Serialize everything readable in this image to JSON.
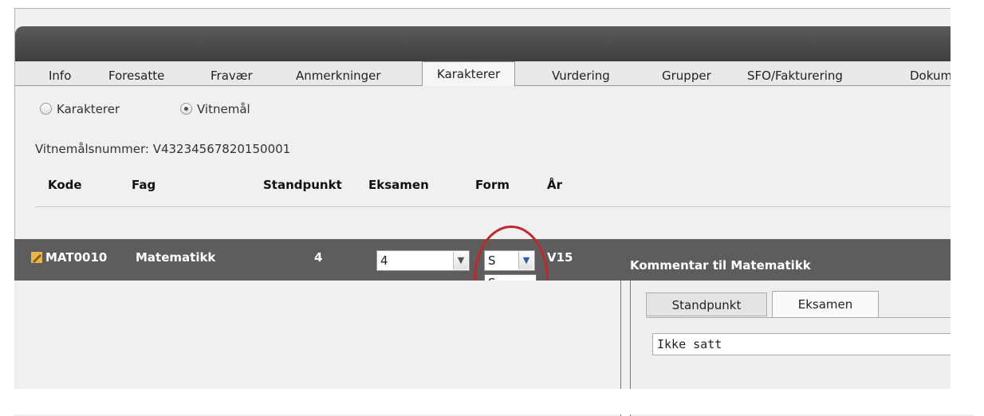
{
  "tabs": [
    {
      "label": "Info"
    },
    {
      "label": "Foresatte"
    },
    {
      "label": "Fravær"
    },
    {
      "label": "Anmerkninger"
    },
    {
      "label": "Karakterer"
    },
    {
      "label": "Vurdering"
    },
    {
      "label": "Grupper"
    },
    {
      "label": "SFO/Fakturering"
    },
    {
      "label": "Dokum"
    }
  ],
  "radios": [
    {
      "label": "Karakterer",
      "selected": false
    },
    {
      "label": "Vitnemål",
      "selected": true
    }
  ],
  "vitnemal_number": "Vitnemålsnummer: V43234567820150001",
  "columns": [
    "Kode",
    "Fag",
    "Standpunkt",
    "Eksamen",
    "Form",
    "År"
  ],
  "subject_row": {
    "kode": "MAT0010",
    "fag": "Matematikk",
    "standpunkt": "4",
    "eksamen_value": "4",
    "form_value": "S",
    "year": "V15"
  },
  "form_dropdown_options": [
    "S",
    "--"
  ],
  "comment_title": "Kommentar til Matematikk",
  "comment_tabs": [
    "Standpunkt",
    "Eksamen"
  ],
  "comment_select_value": "Ikke satt",
  "colors": {
    "highlight": "#3399ff",
    "annotation": "#c0282b",
    "bar": "#5d5d5d"
  }
}
